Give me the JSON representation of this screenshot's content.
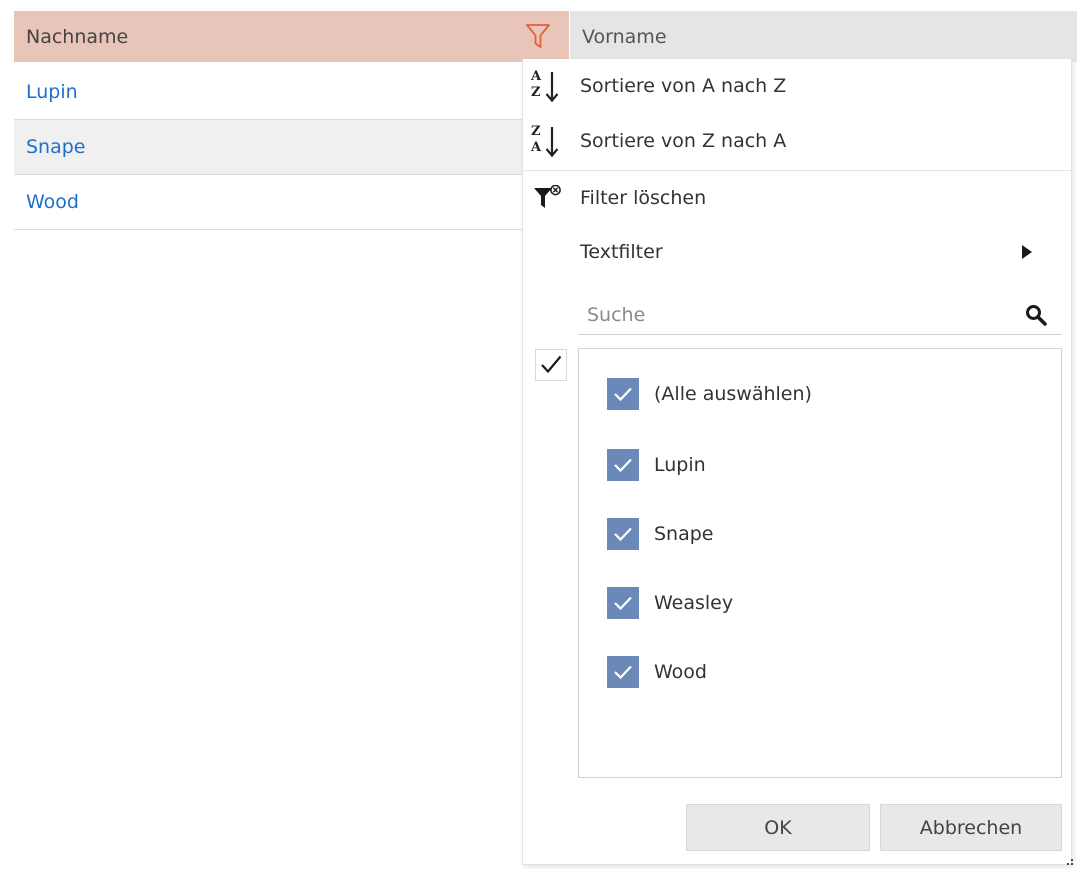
{
  "grid": {
    "columns": [
      {
        "label": "Nachname"
      },
      {
        "label": "Vorname"
      }
    ],
    "rows": [
      {
        "nachname": "Lupin"
      },
      {
        "nachname": "Snape"
      },
      {
        "nachname": "Wood"
      }
    ]
  },
  "filter_menu": {
    "sort_az": {
      "label": "Sortiere von A nach Z",
      "icon": "sort-a-to-z-icon",
      "icon_top": "A",
      "icon_bottom": "Z"
    },
    "sort_za": {
      "label": "Sortiere von Z nach A",
      "icon": "sort-z-to-a-icon",
      "icon_top": "Z",
      "icon_bottom": "A"
    },
    "clear_filter": {
      "label": "Filter löschen",
      "icon": "clear-filter-icon"
    },
    "text_filter": {
      "label": "Textfilter",
      "icon": "submenu-arrow-icon"
    },
    "search": {
      "placeholder": "Suche",
      "value": "",
      "icon": "search-icon"
    },
    "values": [
      {
        "label": "(Alle auswählen)",
        "checked": true
      },
      {
        "label": "Lupin",
        "checked": true
      },
      {
        "label": "Snape",
        "checked": true
      },
      {
        "label": "Weasley",
        "checked": true
      },
      {
        "label": "Wood",
        "checked": true
      }
    ],
    "ok_label": "OK",
    "cancel_label": "Abbrechen"
  },
  "colors": {
    "active_header": "#e8c5b8",
    "header": "#e5e5e5",
    "link_text": "#1e6fc9",
    "filter_icon": "#e0623a",
    "checkbox_fill": "#6b89b8"
  }
}
